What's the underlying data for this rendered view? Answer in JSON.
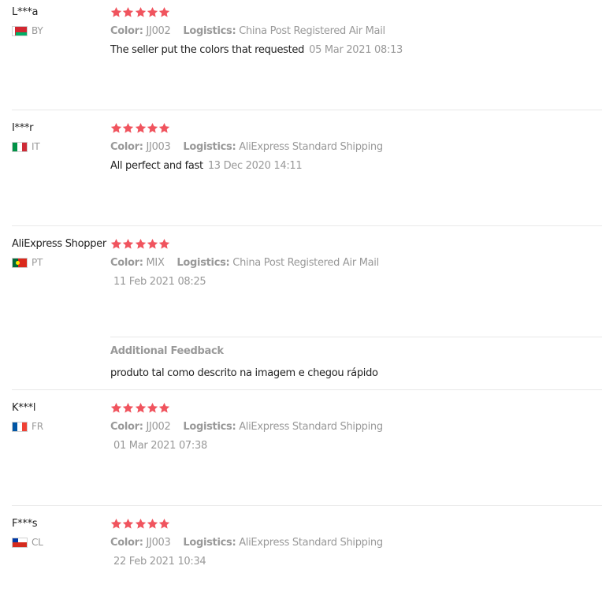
{
  "colors": {
    "star": "#f0545e",
    "muted": "#999999",
    "text": "#222222",
    "divider": "#e8e8e8"
  },
  "labels": {
    "color": "Color:",
    "logistics": "Logistics:"
  },
  "reviews": [
    {
      "user": "L***a",
      "country": "BY",
      "flag_icon": "belarus-flag-icon",
      "rating": 5,
      "color": "JJ002",
      "logistics": "China Post Registered Air Mail",
      "text": "The seller put the colors that requested",
      "date": "05 Mar 2021 08:13"
    },
    {
      "user": "I***r",
      "country": "IT",
      "flag_icon": "italy-flag-icon",
      "rating": 5,
      "color": "JJ003",
      "logistics": "AliExpress Standard Shipping",
      "text": "All perfect and fast",
      "date": "13 Dec 2020 14:11"
    },
    {
      "user": "AliExpress Shopper",
      "country": "PT",
      "flag_icon": "portugal-flag-icon",
      "rating": 5,
      "color": "MIX",
      "logistics": "China Post Registered Air Mail",
      "text": "",
      "date": "11 Feb 2021 08:25",
      "additional_title": "Additional Feedback",
      "additional_text": "produto tal como descrito na imagem e chegou rápido"
    },
    {
      "user": "K***l",
      "country": "FR",
      "flag_icon": "france-flag-icon",
      "rating": 5,
      "color": "JJ002",
      "logistics": "AliExpress Standard Shipping",
      "text": "",
      "date": "01 Mar 2021 07:38"
    },
    {
      "user": "F***s",
      "country": "CL",
      "flag_icon": "chile-flag-icon",
      "rating": 5,
      "color": "JJ003",
      "logistics": "AliExpress Standard Shipping",
      "text": "",
      "date": "22 Feb 2021 10:34"
    }
  ]
}
